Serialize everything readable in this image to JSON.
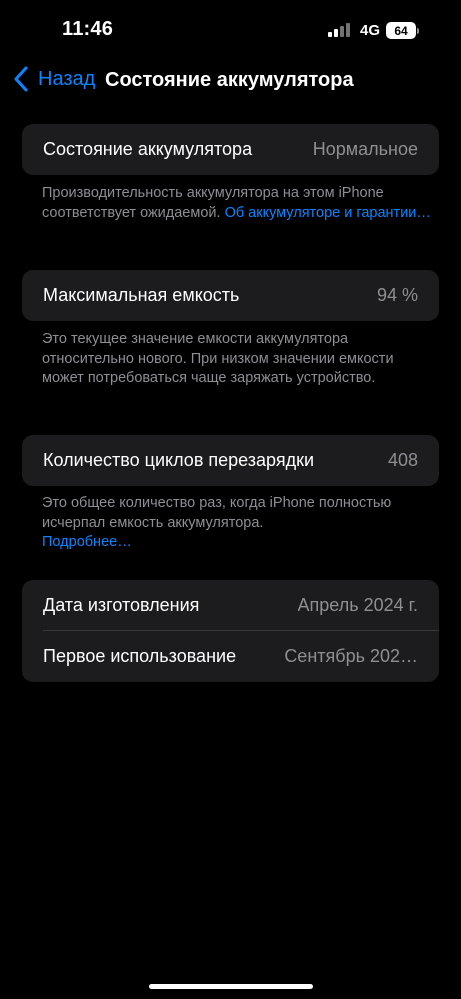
{
  "status_bar": {
    "time": "11:46",
    "network": "4G",
    "battery_level": "64",
    "signal_icon": "signal-bars-icon",
    "battery_icon": "battery-icon"
  },
  "nav": {
    "back_label": "Назад",
    "back_icon": "chevron-left-icon",
    "title": "Состояние аккумулятора",
    "accent_color": "#0a84ff"
  },
  "battery_health": {
    "label": "Состояние аккумулятора",
    "value": "Нормальное",
    "footnote_text": "Производительность аккумулятора на этом iPhone соответствует ожидаемой. ",
    "footnote_link": "Об аккумуля­торе и гарантии…"
  },
  "max_capacity": {
    "label": "Максимальная емкость",
    "value": "94 %",
    "footnote_text": "Это текущее значение емкости аккумулятора относительно нового. При низком значении емкости может потребоваться чаще заряжать устройство."
  },
  "cycle_count": {
    "label": "Количество циклов перезарядки",
    "value": "408",
    "footnote_text": "Это общее количество раз, когда iPhone полностью исчерпал емкость аккумулятора.",
    "footnote_link": "Подробнее…"
  },
  "dates": {
    "manufacture_label": "Дата изготовления",
    "manufacture_value": "Апрель 2024 г.",
    "first_use_label": "Первое использование",
    "first_use_value": "Сентябрь 202…"
  }
}
